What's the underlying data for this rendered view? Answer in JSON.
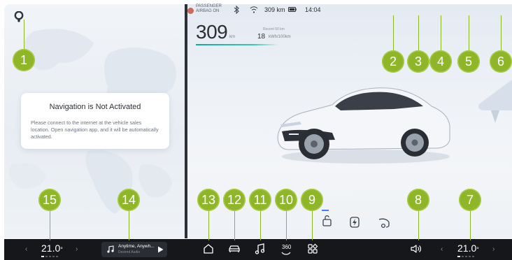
{
  "navigation": {
    "card_title": "Navigation is Not Activated",
    "card_body": "Please connect to the internet at the vehicle sales location. Open navigation app, and it will be automatically activated."
  },
  "vehicle": {
    "speed": "309",
    "speed_unit": "km",
    "consumption_label": "Recent 50 km",
    "consumption_value": "18",
    "consumption_unit": "kWh/100km"
  },
  "status_bar": {
    "airbag_line1": "PASSENGER",
    "airbag_line2": "AIRBAG ON",
    "range": "309 km",
    "clock": "14:04"
  },
  "climate": {
    "left_temp": "21.0",
    "right_temp": "21.0",
    "degree": "°",
    "chev_left": "‹",
    "chev_right": "›"
  },
  "media": {
    "title": "Anytime, Anywh...",
    "source": "Desired Audio"
  },
  "dock": {
    "camera_label": "360"
  },
  "markers": [
    "1",
    "2",
    "3",
    "4",
    "5",
    "6",
    "7",
    "8",
    "9",
    "10",
    "11",
    "12",
    "13",
    "14",
    "15"
  ],
  "colors": {
    "marker": "#8fb629",
    "bottom_bar": "#15171b",
    "arrow": "#8fb629",
    "speed_bar": "#16a7a0"
  }
}
